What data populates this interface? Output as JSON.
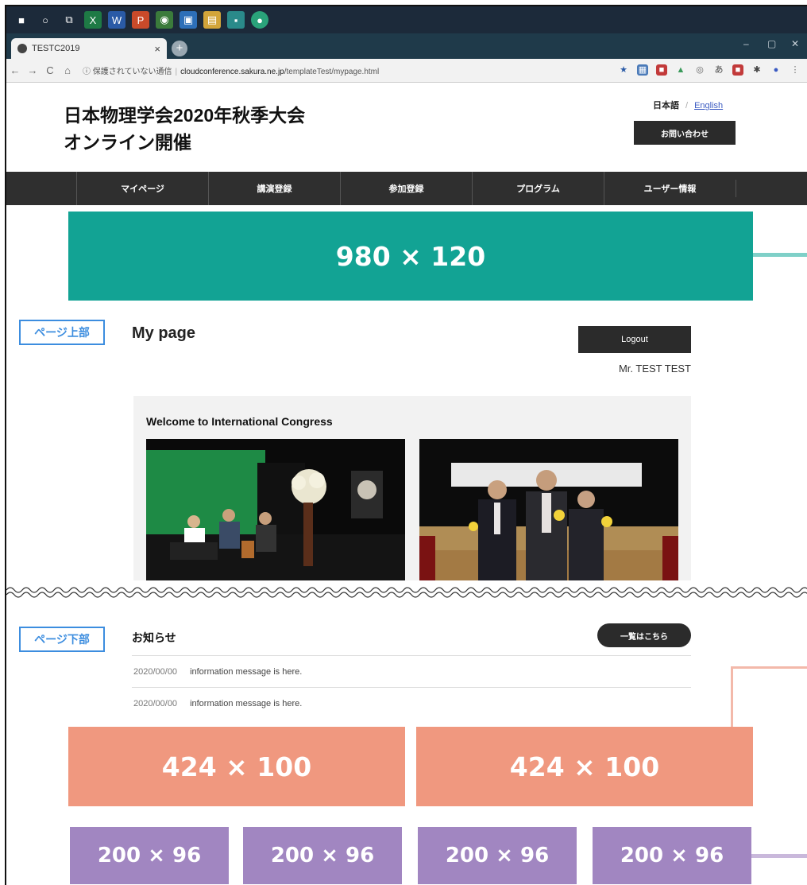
{
  "taskbar": {
    "icons": [
      {
        "name": "windows-start-icon",
        "glyph": "■",
        "color": "#1c2a3a"
      },
      {
        "name": "search-circle-icon",
        "glyph": "○",
        "color": "#1c2a3a"
      },
      {
        "name": "task-view-icon",
        "glyph": "⧉",
        "color": "#1c2a3a"
      },
      {
        "name": "excel-icon",
        "glyph": "X",
        "color": "#1e7a45"
      },
      {
        "name": "word-icon",
        "glyph": "W",
        "color": "#2a5aa6"
      },
      {
        "name": "powerpoint-icon",
        "glyph": "P",
        "color": "#c94a2a"
      },
      {
        "name": "chrome-icon",
        "glyph": "◉",
        "color": "#3b7b3b"
      },
      {
        "name": "app-blue-icon",
        "glyph": "▣",
        "color": "#2d6fb8"
      },
      {
        "name": "file-explorer-icon",
        "glyph": "▤",
        "color": "#d2a53a"
      },
      {
        "name": "photos-icon",
        "glyph": "▪",
        "color": "#2a8a8a"
      },
      {
        "name": "maps-icon",
        "glyph": "●",
        "color": "#2aa37a"
      }
    ]
  },
  "browser": {
    "tab_title": "TESTC2019",
    "tab_close": "×",
    "new_tab": "+",
    "window_controls": [
      "–",
      "▢",
      "✕"
    ],
    "nav": {
      "back": "←",
      "forward": "→",
      "reload": "C",
      "home": "⌂",
      "info": "ⓘ"
    },
    "url_security_note": "保護されていない通信",
    "url_host": "cloudconference.sakura.ne.jp",
    "url_path": "/templateTest/mypage.html",
    "extensions": [
      {
        "name": "bookmark-star-icon",
        "glyph": "★",
        "color": "#2a5aa6"
      },
      {
        "name": "extension-a-icon",
        "glyph": "▦",
        "color": "#4a7ab8"
      },
      {
        "name": "extension-b-icon",
        "glyph": "■",
        "color": "#c23a3a"
      },
      {
        "name": "extension-c-icon",
        "glyph": "▲",
        "color": "#3a9a5a"
      },
      {
        "name": "extension-d-icon",
        "glyph": "◎",
        "color": "#666666"
      },
      {
        "name": "extension-e-icon",
        "glyph": "あ",
        "color": "#444444"
      },
      {
        "name": "extension-f-icon",
        "glyph": "■",
        "color": "#c23a3a"
      },
      {
        "name": "puzzle-icon",
        "glyph": "✱",
        "color": "#444444"
      },
      {
        "name": "profile-icon",
        "glyph": "●",
        "color": "#3a5ac2"
      },
      {
        "name": "menu-dots-icon",
        "glyph": "⋮",
        "color": "#666666"
      }
    ]
  },
  "site": {
    "title": "日本物理学会2020年秋季大会\nオンライン開催",
    "lang_ja": "日本語",
    "lang_sep": "/",
    "lang_en": "English",
    "contact_label": "お問い合わせ",
    "nav": [
      "マイページ",
      "講演登録",
      "参加登録",
      "プログラム",
      "ユーザー情報"
    ]
  },
  "banners": {
    "top": "980 × 120",
    "mid": [
      "424 × 100",
      "424 × 100"
    ],
    "small": [
      "200 × 96",
      "200 × 96",
      "200 × 96",
      "200 × 96"
    ],
    "colors": {
      "teal": "#12a394",
      "orange": "#f0987f",
      "purple": "#a186c1",
      "teal_line": "#7fd0c8",
      "pink_line": "#f3b9aa",
      "purple_line": "#c9b8db"
    }
  },
  "labels": {
    "page_top": "ページ上部",
    "page_bottom": "ページ下部"
  },
  "mypage": {
    "title": "My page",
    "logout": "Logout",
    "user_name": "Mr. TEST TEST",
    "welcome_title": "Welcome to International Congress"
  },
  "news": {
    "title": "お知らせ",
    "more": "一覧はこちら",
    "items": [
      {
        "date": "2020/00/00",
        "text": "information message is here."
      },
      {
        "date": "2020/00/00",
        "text": "information message is here."
      }
    ]
  }
}
